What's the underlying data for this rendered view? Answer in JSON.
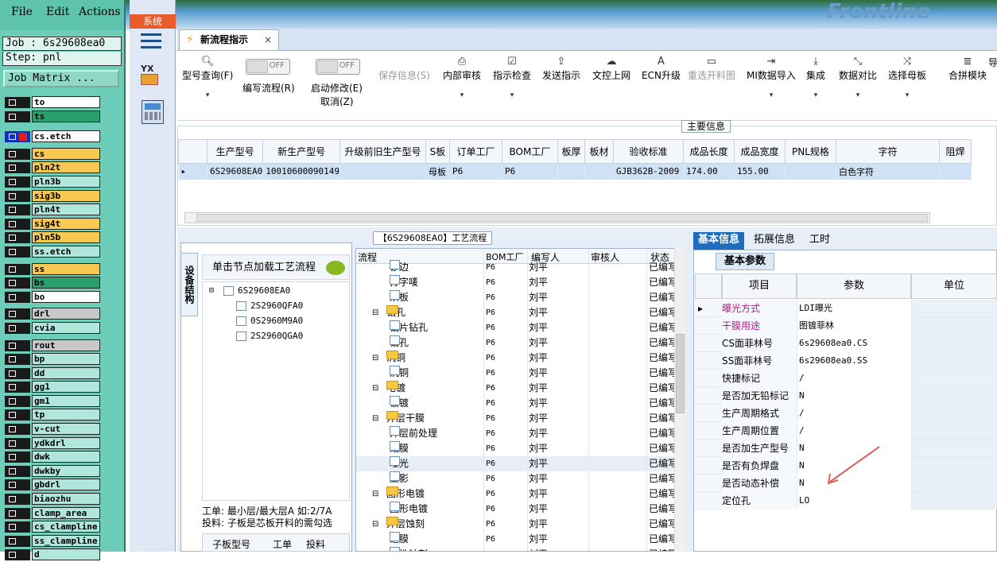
{
  "cam": {
    "menu": {
      "file": "File",
      "edit": "Edit",
      "actions": "Actions"
    },
    "job": "Job : 6s29608ea0",
    "step": "Step: pnl",
    "job_matrix": "Job Matrix ...",
    "layers": [
      {
        "name": "to",
        "color": "w"
      },
      {
        "name": "ts",
        "color": "g"
      },
      {
        "name": "cs.etch",
        "color": "w"
      },
      {
        "name": "cs",
        "color": "o"
      },
      {
        "name": "pln2t",
        "color": "o"
      },
      {
        "name": "pln3b",
        "color": "t"
      },
      {
        "name": "sig3b",
        "color": "o"
      },
      {
        "name": "pln4t",
        "color": "t"
      },
      {
        "name": "sig4t",
        "color": "o"
      },
      {
        "name": "pln5b",
        "color": "o"
      },
      {
        "name": "ss.etch",
        "color": "t"
      },
      {
        "name": "ss",
        "color": "o"
      },
      {
        "name": "bs",
        "color": "g"
      },
      {
        "name": "bo",
        "color": "w"
      },
      {
        "name": "drl",
        "color": "gr"
      },
      {
        "name": "cvia",
        "color": "t"
      },
      {
        "name": "rout",
        "color": "gr"
      },
      {
        "name": "bp",
        "color": "t"
      },
      {
        "name": "dd",
        "color": "t"
      },
      {
        "name": "gg1",
        "color": "t"
      },
      {
        "name": "gm1",
        "color": "t"
      },
      {
        "name": "tp",
        "color": "t"
      },
      {
        "name": "v-cut",
        "color": "t"
      },
      {
        "name": "ydkdrl",
        "color": "t"
      },
      {
        "name": "dwk",
        "color": "t"
      },
      {
        "name": "dwkby",
        "color": "t"
      },
      {
        "name": "gbdrl",
        "color": "t"
      },
      {
        "name": "biaozhu",
        "color": "t"
      },
      {
        "name": "clamp_area",
        "color": "t"
      },
      {
        "name": "cs_clampline",
        "color": "t"
      },
      {
        "name": "ss_clampline",
        "color": "t"
      },
      {
        "name": "d",
        "color": "t"
      }
    ]
  },
  "app": {
    "sys_tab": "系统",
    "brand": "Frontline",
    "tab_title": "新流程指示",
    "tab_close": "×"
  },
  "ribbon": {
    "type_query": "型号查询(F)",
    "toggle_off": "OFF",
    "edit_flow": "编写流程(R)",
    "start_modify": "启动修改(E)",
    "cancel": "取消(Z)",
    "save_info": "保存信息(S)",
    "internal_review": "内部审核",
    "instruction_check": "指示检查",
    "send_instruction": "发送指示",
    "upload": "文控上网",
    "ecn_upgrade": "ECN升级",
    "reselect": "重选开料图",
    "mi_import": "MI数据导入",
    "integrate": "集成",
    "data_compare": "数据对比",
    "select_mother": "选择母板",
    "merge_module": "合拼模块",
    "last": "导"
  },
  "main_info": {
    "title": "主要信息",
    "headers": [
      "生产型号",
      "新生产型号",
      "升级前旧生产型号",
      "S板",
      "订单工厂",
      "BOM工厂",
      "板厚",
      "板材",
      "验收标准",
      "成品长度",
      "成品宽度",
      "PNL规格",
      "字符",
      "阻焊"
    ],
    "row": [
      "6S29608EA0",
      "10010600090149",
      "",
      "母板",
      "P6",
      "P6",
      "",
      "",
      "GJB362B-2009",
      "174.00",
      "155.00",
      "",
      "白色字符",
      ""
    ]
  },
  "process": {
    "title": "【6S29608EA0】工艺流程",
    "side_tab": "设备结构",
    "hint": "单击节点加载工艺流程",
    "job_tree": [
      "6S29608EA0",
      "2S2960QFA0",
      "0S2960M9A0",
      "2S2960QGA0"
    ],
    "note_line1": "工单: 最小层/最大层A 如:2/7A",
    "note_line2": "投料: 子板是芯板开料的需勾选",
    "sub_headers": [
      "子板型号",
      "工单",
      "投料"
    ],
    "headers": [
      "流程",
      "BOM工厂",
      "编写人",
      "审核人",
      "状态"
    ],
    "rows": [
      {
        "name": "锣边",
        "level": 2,
        "folder": false,
        "bom": "P6",
        "writer": "刘平",
        "status": "已编写"
      },
      {
        "name": "打字唛",
        "level": 2,
        "folder": false,
        "bom": "P6",
        "writer": "刘平",
        "status": "已编写"
      },
      {
        "name": "烘板",
        "level": 2,
        "folder": false,
        "bom": "P6",
        "writer": "刘平",
        "status": "已编写"
      },
      {
        "name": "钻孔",
        "level": 1,
        "folder": true,
        "bom": "P6",
        "writer": "刘平",
        "status": "已编写"
      },
      {
        "name": "铝片钻孔",
        "level": 2,
        "folder": false,
        "bom": "P6",
        "writer": "刘平",
        "status": "已编写"
      },
      {
        "name": "钻孔",
        "level": 2,
        "folder": false,
        "bom": "P6",
        "writer": "刘平",
        "status": "已编写"
      },
      {
        "name": "沉铜",
        "level": 1,
        "folder": true,
        "bom": "P6",
        "writer": "刘平",
        "status": "已编写"
      },
      {
        "name": "沉铜",
        "level": 2,
        "folder": false,
        "bom": "P6",
        "writer": "刘平",
        "status": "已编写"
      },
      {
        "name": "电镀",
        "level": 1,
        "folder": true,
        "bom": "P6",
        "writer": "刘平",
        "status": "已编写"
      },
      {
        "name": "板镀",
        "level": 2,
        "folder": false,
        "bom": "P6",
        "writer": "刘平",
        "status": "已编写"
      },
      {
        "name": "外层干膜",
        "level": 1,
        "folder": true,
        "bom": "P6",
        "writer": "刘平",
        "status": "已编写"
      },
      {
        "name": "外层前处理",
        "level": 2,
        "folder": false,
        "bom": "P6",
        "writer": "刘平",
        "status": "已编写"
      },
      {
        "name": "贴膜",
        "level": 2,
        "folder": false,
        "bom": "P6",
        "writer": "刘平",
        "status": "已编写"
      },
      {
        "name": "曝光",
        "level": 2,
        "folder": false,
        "bom": "P6",
        "writer": "刘平",
        "status": "已编写",
        "selected": true
      },
      {
        "name": "显影",
        "level": 2,
        "folder": false,
        "bom": "P6",
        "writer": "刘平",
        "status": "已编写"
      },
      {
        "name": "图形电镀",
        "level": 1,
        "folder": true,
        "bom": "P6",
        "writer": "刘平",
        "status": "已编写"
      },
      {
        "name": "图形电镀",
        "level": 2,
        "folder": false,
        "bom": "P6",
        "writer": "刘平",
        "status": "已编写"
      },
      {
        "name": "外层蚀刻",
        "level": 1,
        "folder": true,
        "bom": "P6",
        "writer": "刘平",
        "status": "已编写"
      },
      {
        "name": "退膜",
        "level": 2,
        "folder": false,
        "bom": "P6",
        "writer": "刘平",
        "status": "已编写"
      },
      {
        "name": "碱性蚀刻",
        "level": 2,
        "folder": false,
        "bom": "P6",
        "writer": "刘平",
        "status": "已编写"
      }
    ]
  },
  "info_panel": {
    "tabs": [
      "基本信息",
      "拓展信息",
      "工时"
    ],
    "section": "基本参数",
    "headers": [
      "项目",
      "参数",
      "单位"
    ],
    "rows": [
      {
        "key": "曝光方式",
        "value": "LDI曝光",
        "highlight": true
      },
      {
        "key": "干膜用途",
        "value": "图镀菲林",
        "highlight": true
      },
      {
        "key": "CS面菲林号",
        "value": "6s29608ea0.CS"
      },
      {
        "key": "SS面菲林号",
        "value": "6s29608ea0.SS"
      },
      {
        "key": "快捷标记",
        "value": "/"
      },
      {
        "key": "是否加无铅标记",
        "value": "N"
      },
      {
        "key": "生产周期格式",
        "value": "/"
      },
      {
        "key": "生产周期位置",
        "value": "/"
      },
      {
        "key": "是否加生产型号",
        "value": "N"
      },
      {
        "key": "是否有负焊盘",
        "value": "N"
      },
      {
        "key": "是否动态补偿",
        "value": "N"
      },
      {
        "key": "定位孔",
        "value": "LO"
      }
    ]
  }
}
